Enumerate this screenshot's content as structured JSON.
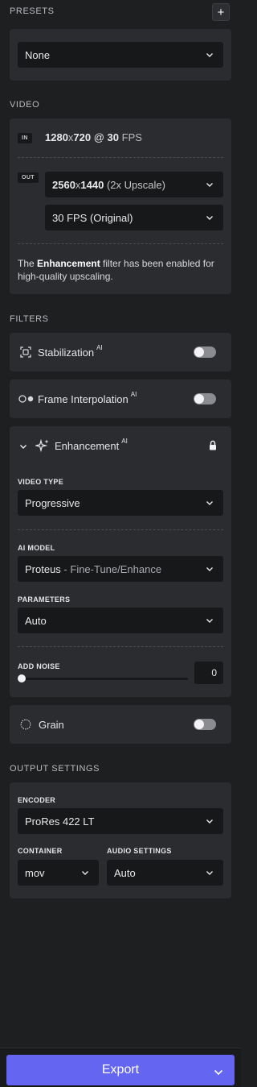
{
  "presets": {
    "section_label": "PRESETS",
    "add_label": "+",
    "selected": "None"
  },
  "video": {
    "section_label": "VIDEO",
    "in_badge": "IN",
    "out_badge": "OUT",
    "in_res": "1280",
    "in_x": "x",
    "in_res2": "720",
    "in_at": " @ ",
    "in_fps": "30",
    "in_fps_unit": " FPS",
    "out_res": "2560",
    "out_x": "x",
    "out_res2": "1440",
    "out_res_note": " (2x Upscale)",
    "out_fps": "30 FPS (Original)",
    "note_pre": "The ",
    "note_bold": "Enhancement",
    "note_post": " filter has been enabled for high-quality upscaling."
  },
  "filters": {
    "section_label": "FILTERS",
    "stabilization": {
      "label": "Stabilization",
      "ai": "AI",
      "enabled": false
    },
    "interpolation": {
      "label": "Frame Interpolation",
      "ai": "AI",
      "enabled": false
    },
    "enhancement": {
      "label": "Enhancement",
      "ai": "AI",
      "video_type_label": "VIDEO TYPE",
      "video_type": "Progressive",
      "ai_model_label": "AI MODEL",
      "ai_model_name": "Proteus",
      "ai_model_sep": " - ",
      "ai_model_desc": "Fine-Tune/Enhance",
      "parameters_label": "PARAMETERS",
      "parameters": "Auto",
      "add_noise_label": "ADD NOISE",
      "add_noise_value": "0",
      "add_noise_level": 0
    },
    "grain": {
      "label": "Grain",
      "enabled": false
    }
  },
  "output": {
    "section_label": "OUTPUT SETTINGS",
    "encoder_label": "ENCODER",
    "encoder": "ProRes 422 LT",
    "container_label": "CONTAINER",
    "container": "mov",
    "audio_label": "AUDIO SETTINGS",
    "audio": "Auto"
  },
  "export": {
    "label": "Export"
  },
  "colors": {
    "accent": "#6466f1",
    "panel": "#2b2c30",
    "background": "#1e1f21",
    "field": "#17181a"
  },
  "icons": {
    "chevron": "chevron-down-icon",
    "lock": "lock-icon",
    "sparkle": "sparkles-icon",
    "stabilize": "stabilize-icon",
    "interpolate": "interpolation-icon",
    "grain": "grain-icon"
  }
}
